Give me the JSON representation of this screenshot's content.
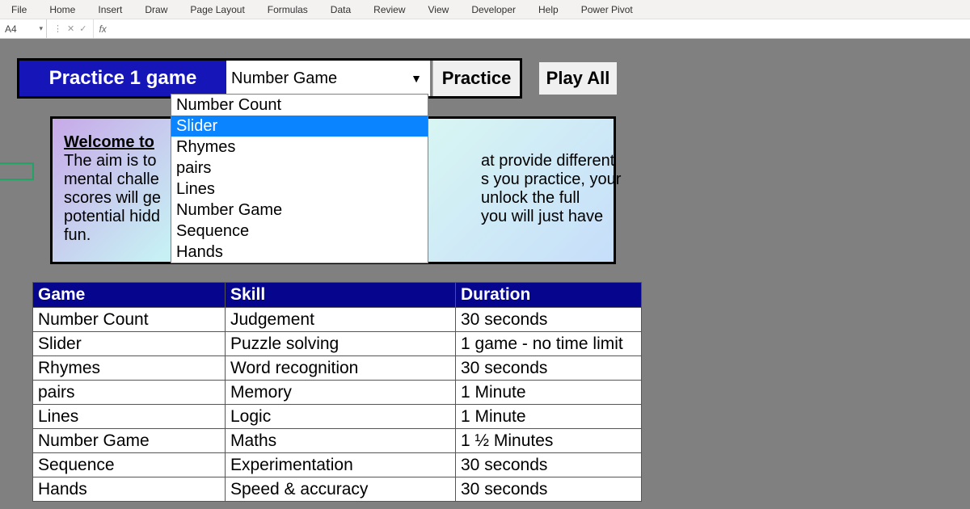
{
  "ribbon": {
    "tabs": [
      "File",
      "Home",
      "Insert",
      "Draw",
      "Page Layout",
      "Formulas",
      "Data",
      "Review",
      "View",
      "Developer",
      "Help",
      "Power Pivot"
    ]
  },
  "formula_bar": {
    "cell_ref": "A4",
    "cancel_icon": "✕",
    "accept_icon": "✓",
    "fx_label": "fx",
    "value": ""
  },
  "controls": {
    "practice1_label": "Practice 1 game",
    "selected_game": "Number Game",
    "practice_btn": "Practice",
    "playall_btn": "Play All"
  },
  "dropdown": {
    "highlighted_index": 1,
    "items": [
      "Number Count",
      "Slider",
      "Rhymes",
      "pairs",
      "Lines",
      "Number Game",
      "Sequence",
      "Hands"
    ]
  },
  "welcome": {
    "title": "Welcome to",
    "line1": "The aim is to",
    "line2": "mental challe",
    "line3": "scores will ge",
    "line4": "potential hidd",
    "line5": "fun.",
    "r1": "at provide different",
    "r2": "s you practice, your",
    "r3": "unlock the full",
    "r4": "you will just have"
  },
  "table": {
    "headers": {
      "game": "Game",
      "skill": "Skill",
      "duration": "Duration"
    },
    "rows": [
      {
        "game": "Number Count",
        "skill": "Judgement",
        "dur": "30 seconds"
      },
      {
        "game": "Slider",
        "skill": "Puzzle solving",
        "dur": "1 game - no time limit"
      },
      {
        "game": "Rhymes",
        "skill": "Word recognition",
        "dur": "30 seconds"
      },
      {
        "game": "pairs",
        "skill": "Memory",
        "dur": "1 Minute"
      },
      {
        "game": "Lines",
        "skill": "Logic",
        "dur": "1 Minute"
      },
      {
        "game": "Number Game",
        "skill": "Maths",
        "dur": "1 ½ Minutes"
      },
      {
        "game": "Sequence",
        "skill": "Experimentation",
        "dur": "30 seconds"
      },
      {
        "game": "Hands",
        "skill": "Speed & accuracy",
        "dur": "30 seconds"
      }
    ]
  }
}
